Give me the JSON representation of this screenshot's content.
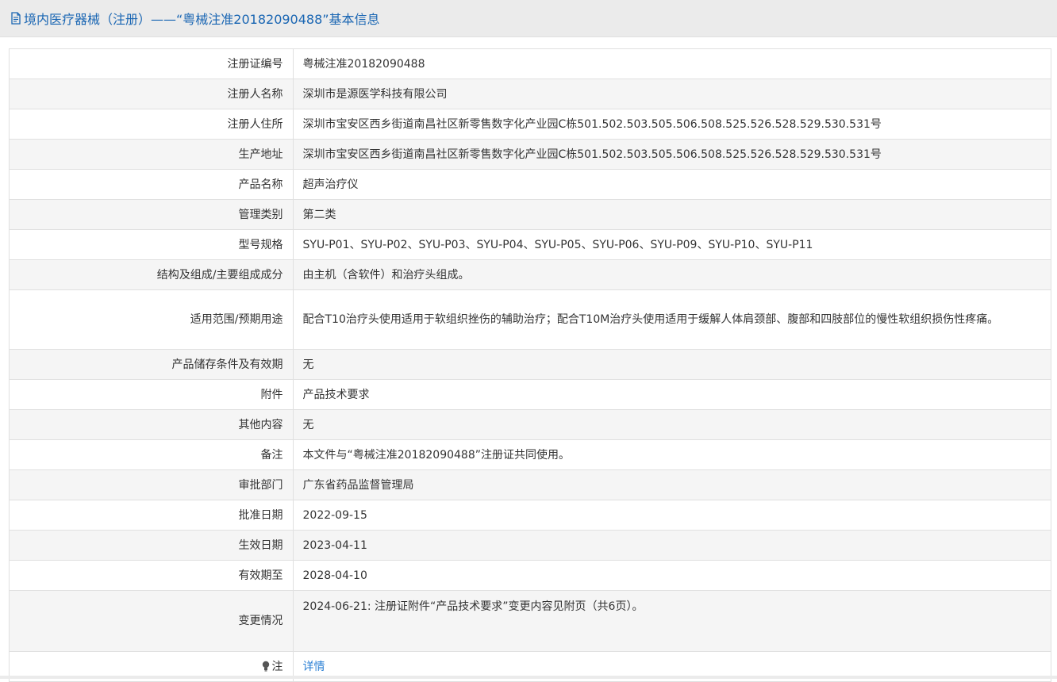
{
  "header": {
    "title": "境内医疗器械（注册）——“粤械注准20182090488”基本信息",
    "icon": "document-icon"
  },
  "rows": [
    {
      "label": "注册证编号",
      "value": "粤械注准20182090488"
    },
    {
      "label": "注册人名称",
      "value": "深圳市是源医学科技有限公司"
    },
    {
      "label": "注册人住所",
      "value": "深圳市宝安区西乡街道南昌社区新零售数字化产业园C栋501.502.503.505.506.508.525.526.528.529.530.531号"
    },
    {
      "label": "生产地址",
      "value": "深圳市宝安区西乡街道南昌社区新零售数字化产业园C栋501.502.503.505.506.508.525.526.528.529.530.531号"
    },
    {
      "label": "产品名称",
      "value": "超声治疗仪"
    },
    {
      "label": "管理类别",
      "value": "第二类"
    },
    {
      "label": "型号规格",
      "value": "SYU-P01、SYU-P02、SYU-P03、SYU-P04、SYU-P05、SYU-P06、SYU-P09、SYU-P10、SYU-P11"
    },
    {
      "label": "结构及组成/主要组成成分",
      "value": "由主机（含软件）和治疗头组成。"
    },
    {
      "label": "适用范围/预期用途",
      "value": "配合T10治疗头使用适用于软组织挫伤的辅助治疗；配合T10M治疗头使用适用于缓解人体肩颈部、腹部和四肢部位的慢性软组织损伤性疼痛。"
    },
    {
      "label": "产品储存条件及有效期",
      "value": "无"
    },
    {
      "label": "附件",
      "value": "产品技术要求"
    },
    {
      "label": "其他内容",
      "value": "无"
    },
    {
      "label": "备注",
      "value": "本文件与“粤械注准20182090488”注册证共同使用。"
    },
    {
      "label": "审批部门",
      "value": "广东省药品监督管理局"
    },
    {
      "label": "批准日期",
      "value": "2022-09-15"
    },
    {
      "label": "生效日期",
      "value": "2023-04-11"
    },
    {
      "label": "有效期至",
      "value": "2028-04-10"
    },
    {
      "label": "变更情况",
      "value": "2024-06-21: 注册证附件“产品技术要求”变更内容见附页（共6页）。"
    }
  ],
  "note_row": {
    "label": "注",
    "link": "详情",
    "icon": "lightbulb-icon"
  },
  "colors": {
    "header_text": "#1a66b3",
    "link": "#2a7fd4",
    "border": "#e0e0e0",
    "stripe": "#f5f5f5",
    "header_bg": "#ebebeb"
  }
}
